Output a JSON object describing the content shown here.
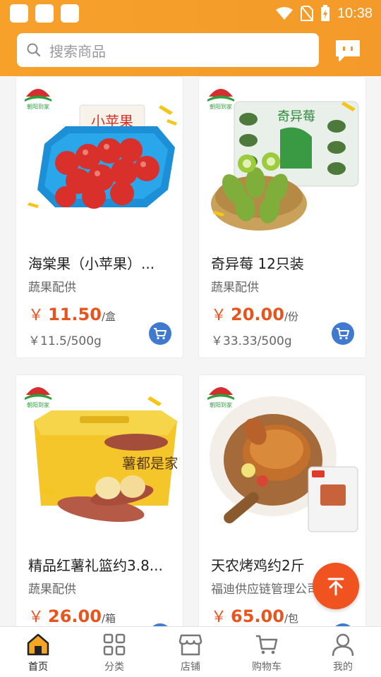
{
  "status_bar": {
    "time": "10:38"
  },
  "search": {
    "placeholder": "搜索商品"
  },
  "brand_logo_text": "朝阳到家",
  "products": [
    {
      "title": "海棠果（小苹果）...",
      "supplier": "蔬果配供",
      "currency": "￥",
      "price": "11.50",
      "unit": "/盒",
      "unit_price": "￥11.5/500g",
      "package_text": "小苹果"
    },
    {
      "title": "奇异莓 12只装",
      "supplier": "蔬果配供",
      "currency": "￥",
      "price": "20.00",
      "unit": "/份",
      "unit_price": "￥33.33/500g",
      "package_text": "奇异莓"
    },
    {
      "title": "精品红薯礼篮约3.8...",
      "supplier": "蔬果配供",
      "currency": "￥",
      "price": "26.00",
      "unit": "/箱",
      "unit_price": "",
      "package_text": "薯都是家"
    },
    {
      "title": "天农烤鸡约2斤",
      "supplier": "福迪供应链管理公司",
      "currency": "￥",
      "price": "65.00",
      "unit": "/包",
      "unit_price": "",
      "package_text": ""
    }
  ],
  "tabs": [
    {
      "label": "首页",
      "icon": "home-icon",
      "active": true
    },
    {
      "label": "分类",
      "icon": "grid-icon",
      "active": false
    },
    {
      "label": "店铺",
      "icon": "store-icon",
      "active": false
    },
    {
      "label": "购物车",
      "icon": "cart-icon",
      "active": false
    },
    {
      "label": "我的",
      "icon": "user-icon",
      "active": false
    }
  ],
  "colors": {
    "header": "#f39a2a",
    "price": "#e8541e",
    "cart_button": "#3f7ad0",
    "fab": "#f0531f"
  }
}
